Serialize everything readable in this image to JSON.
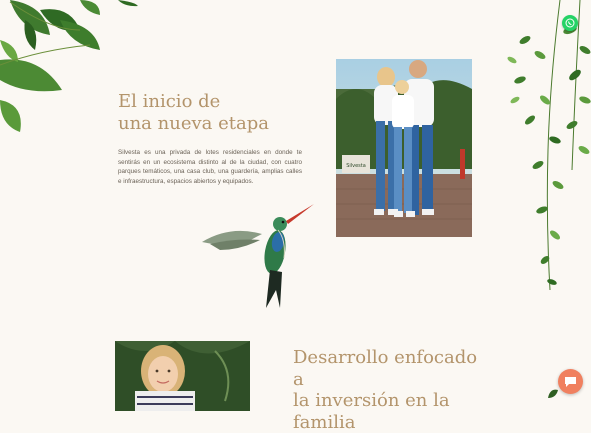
{
  "section_intro": {
    "heading_line1": "El inicio de",
    "heading_line2": "una nueva etapa",
    "paragraph": "Silvesta es una privada de lotes residenciales en donde te sentirás en un ecosistema distinto al de la ciudad, con cuatro parques temáticos, una casa club, una guardería, amplias calles e infraestructura, espacios abiertos y equipados."
  },
  "section_investment": {
    "heading_line1": "Desarrollo enfocado a",
    "heading_line2": "la inversión en la",
    "heading_line3": "familia"
  },
  "family_photo": {
    "sign_text": "Silvesta"
  },
  "colors": {
    "background": "#fbf8f3",
    "heading": "#b3946b",
    "whatsapp": "#25d366",
    "chat": "#f0805f"
  },
  "icons": {
    "whatsapp": "whatsapp-icon",
    "chat": "chat-bubble-icon",
    "bird": "hummingbird-illustration"
  }
}
